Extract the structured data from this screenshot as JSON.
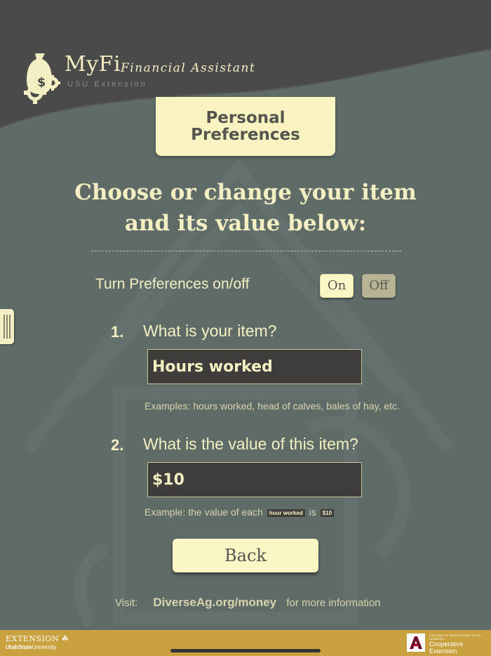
{
  "header": {
    "app_name": "MyFi",
    "app_subtitle": "Financial Assistant",
    "org_label": "USU Extension"
  },
  "section": {
    "title_line1": "Personal",
    "title_line2": "Preferences"
  },
  "heading": {
    "line1": "Choose or change your item",
    "line2": "and its value below:"
  },
  "preferences_toggle": {
    "label": "Turn Preferences on/off",
    "on_label": "On",
    "off_label": "Off",
    "selected": "On"
  },
  "question1": {
    "number": "1.",
    "text": "What is your item?",
    "value": "Hours worked",
    "hint": "Examples: hours worked, head of calves, bales of hay, etc."
  },
  "question2": {
    "number": "2.",
    "text": "What is the value of this item?",
    "value": "$10",
    "hint_prefix": "Example: the value of each",
    "hint_item_chip": "hour worked",
    "hint_middle": "is",
    "hint_value_chip": "$10"
  },
  "back_button": {
    "label": "Back"
  },
  "footer_link": {
    "prefix": "Visit:",
    "link": "DiverseAg.org/money",
    "suffix": "for more information"
  },
  "footer": {
    "left_line1": "Extension",
    "left_line2_bold": "UtahState",
    "left_line2_rest": "University",
    "right_small": "COLLEGE OF AGRICULTURE & LIFE SCIENCES",
    "right_line1": "Cooperative",
    "right_line2": "Extension"
  },
  "colors": {
    "background": "#5f6b67",
    "header": "#4a4a4a",
    "cream": "#f8f3c0",
    "footer_gold": "#c9a13f",
    "input_dark": "#3f3d3b"
  },
  "icons": [
    "money-bag-icon",
    "gears-icon",
    "side-drawer-handle-icon",
    "university-of-arizona-logo-icon",
    "four-h-clover-icon"
  ]
}
